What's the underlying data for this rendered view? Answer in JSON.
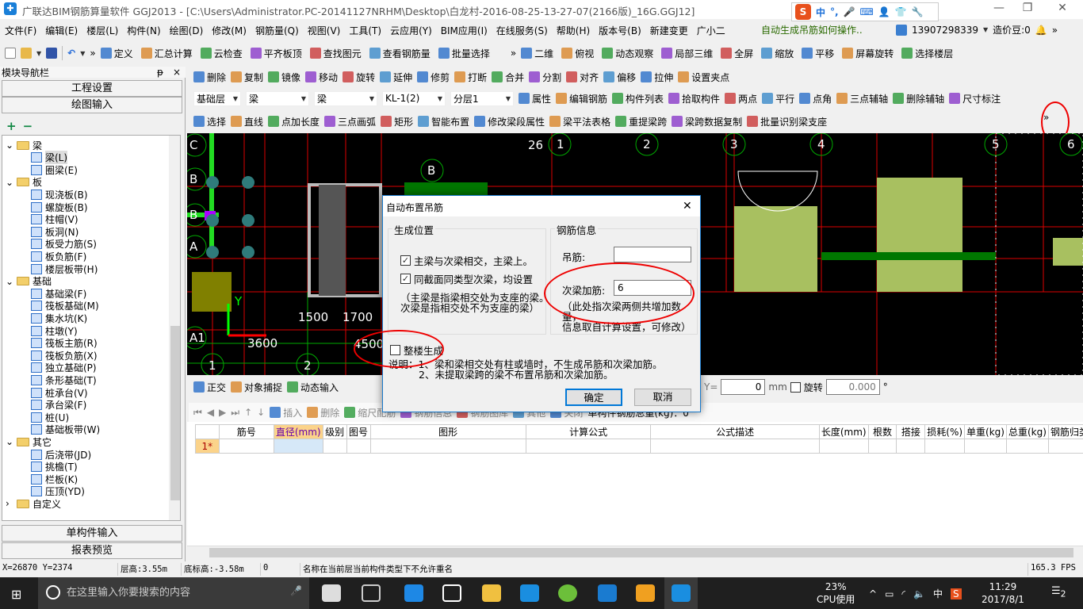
{
  "window": {
    "title": "广联达BIM钢筋算量软件 GGJ2013 - [C:\\Users\\Administrator.PC-20141127NRHM\\Desktop\\白龙村-2016-08-25-13-27-07(2166版)_16G.GGJ12]",
    "app_icon": "glodon-app-icon",
    "minimize": "—",
    "restore": "❐",
    "close": "✕"
  },
  "ime": {
    "logo": "S",
    "lang": "中",
    "punct": "°,",
    "icons": [
      "microphone-icon",
      "keyboard-icon",
      "user-icon",
      "shirt-icon",
      "wrench-icon"
    ]
  },
  "menubar": {
    "items": [
      "文件(F)",
      "编辑(E)",
      "楼层(L)",
      "构件(N)",
      "绘图(D)",
      "修改(M)",
      "钢筋量(Q)",
      "视图(V)",
      "工具(T)",
      "云应用(Y)",
      "BIM应用(I)",
      "在线服务(S)",
      "帮助(H)",
      "版本号(B)",
      "新建变更",
      "广小二"
    ],
    "hint": "自动生成吊筋如何操作..",
    "account": "13907298339",
    "beans": "造价豆:0"
  },
  "toolbar1": {
    "left": [
      "定义",
      "汇总计算",
      "云检查",
      "平齐板顶",
      "查找图元",
      "查看钢筋量",
      "批量选择"
    ],
    "right": [
      "二维",
      "俯视",
      "动态观察",
      "局部三维",
      "全屏",
      "缩放",
      "平移",
      "屏幕旋转",
      "选择楼层"
    ]
  },
  "toolbar2": [
    "删除",
    "复制",
    "镜像",
    "移动",
    "旋转",
    "延伸",
    "修剪",
    "打断",
    "合并",
    "分割",
    "对齐",
    "偏移",
    "拉伸",
    "设置夹点"
  ],
  "toolbar3": {
    "combos": [
      "基础层",
      "梁",
      "梁",
      "KL-1(2)",
      "分层1"
    ],
    "items": [
      "属性",
      "编辑钢筋",
      "构件列表",
      "拾取构件",
      "两点",
      "平行",
      "点角",
      "三点辅轴",
      "删除辅轴",
      "尺寸标注"
    ]
  },
  "toolbar4": [
    "选择",
    "直线",
    "点加长度",
    "三点画弧",
    "矩形",
    "智能布置",
    "修改梁段属性",
    "梁平法表格",
    "重提梁跨",
    "梁跨数据复制",
    "批量识别梁支座"
  ],
  "overflow": "»",
  "left_panel": {
    "title": "模块导航栏",
    "pin": "ᵽ",
    "close": "×",
    "project_settings": "工程设置",
    "drawing_input": "绘图输入",
    "add": "+",
    "remove": "−",
    "single_input": "单构件输入",
    "report_preview": "报表预览",
    "tree": [
      {
        "label": "梁",
        "level": 0,
        "expanded": true
      },
      {
        "label": "梁(L)",
        "level": 1,
        "selected": true
      },
      {
        "label": "圈梁(E)",
        "level": 1
      },
      {
        "label": "板",
        "level": 0,
        "expanded": true
      },
      {
        "label": "现浇板(B)",
        "level": 1
      },
      {
        "label": "螺旋板(B)",
        "level": 1
      },
      {
        "label": "柱帽(V)",
        "level": 1
      },
      {
        "label": "板洞(N)",
        "level": 1
      },
      {
        "label": "板受力筋(S)",
        "level": 1
      },
      {
        "label": "板负筋(F)",
        "level": 1
      },
      {
        "label": "楼层板带(H)",
        "level": 1
      },
      {
        "label": "基础",
        "level": 0,
        "expanded": true
      },
      {
        "label": "基础梁(F)",
        "level": 1
      },
      {
        "label": "筏板基础(M)",
        "level": 1
      },
      {
        "label": "集水坑(K)",
        "level": 1
      },
      {
        "label": "柱墩(Y)",
        "level": 1
      },
      {
        "label": "筏板主筋(R)",
        "level": 1
      },
      {
        "label": "筏板负筋(X)",
        "level": 1
      },
      {
        "label": "独立基础(P)",
        "level": 1
      },
      {
        "label": "条形基础(T)",
        "level": 1
      },
      {
        "label": "桩承台(V)",
        "level": 1
      },
      {
        "label": "承台梁(F)",
        "level": 1
      },
      {
        "label": "桩(U)",
        "level": 1
      },
      {
        "label": "基础板带(W)",
        "level": 1
      },
      {
        "label": "其它",
        "level": 0,
        "expanded": true
      },
      {
        "label": "后浇带(JD)",
        "level": 1
      },
      {
        "label": "挑檐(T)",
        "level": 1
      },
      {
        "label": "栏板(K)",
        "level": 1
      },
      {
        "label": "压顶(YD)",
        "level": 1
      },
      {
        "label": "自定义",
        "level": 0,
        "expanded": false
      }
    ]
  },
  "canvas": {
    "axis_labels": [
      "C",
      "B",
      "B",
      "A",
      "A",
      "A1",
      "B"
    ],
    "col_labels": [
      "1",
      "2",
      "1",
      "2",
      "3",
      "4",
      "5",
      "6"
    ],
    "dims": [
      "3600",
      "1500",
      "1700",
      "4500",
      "26",
      "2"
    ],
    "y_axis": "Y"
  },
  "dialog": {
    "title": "自动布置吊筋",
    "close": "✕",
    "position_group": "生成位置",
    "opt1": "主梁与次梁相交，主梁上。",
    "opt1_checked": true,
    "opt2": "同截面同类型次梁，均设置",
    "opt2_checked": true,
    "note1": "（主梁是指梁相交处为支座的梁。",
    "note2": "次梁是指相交处不为支座的梁）",
    "rebar_group": "钢筋信息",
    "hanger_label": "吊筋:",
    "hanger_value": "",
    "secondary_label": "次梁加筋:",
    "secondary_value": "6",
    "note3": "（此处指次梁两侧共增加数量，",
    "note4": "信息取自计算设置，可修改）",
    "whole_building": "整楼生成",
    "whole_building_checked": false,
    "desc1": "说明：1、梁和梁相交处有柱或墙时，不生成吊筋和次梁加筋。",
    "desc2": "2、未提取梁跨的梁不布置吊筋和次梁加筋。",
    "ok": "确定",
    "cancel": "取消"
  },
  "snapbar": {
    "items": [
      "正交",
      "对象捕捉",
      "动态输入"
    ],
    "y_label": "Y=",
    "y_value": "0",
    "unit": "mm",
    "rotate": "旋转",
    "rotate_value": "0.000",
    "deg": "°"
  },
  "gridbar": {
    "items": [
      "插入",
      "删除",
      "缩尺配筋",
      "钢筋信息",
      "钢筋图库",
      "其他",
      "关闭"
    ],
    "total": "单构件钢筋总重(kg)：0"
  },
  "table": {
    "headers": [
      "",
      "筋号",
      "直径(mm)",
      "级别",
      "图号",
      "图形",
      "计算公式",
      "公式描述",
      "长度(mm)",
      "根数",
      "搭接",
      "损耗(%)",
      "单重(kg)",
      "总重(kg)",
      "钢筋归类"
    ],
    "rows": [
      [
        "1*",
        "",
        "",
        "",
        "",
        "",
        "",
        "",
        "",
        "",
        "",
        "",
        "",
        "",
        ""
      ]
    ]
  },
  "status": {
    "coords": "X=26870 Y=2374",
    "floor_height": "层高:3.55m",
    "bottom_elev": "底标高:-3.58m",
    "value": "0",
    "message": "名称在当前层当前构件类型下不允许重名",
    "fps": "165.3 FPS"
  },
  "taskbar": {
    "search_placeholder": "在这里输入你要搜索的内容",
    "cpu": "23%",
    "cpu_label": "CPU使用",
    "ime": "中",
    "time": "11:29",
    "date": "2017/8/1",
    "notifications": "2"
  }
}
